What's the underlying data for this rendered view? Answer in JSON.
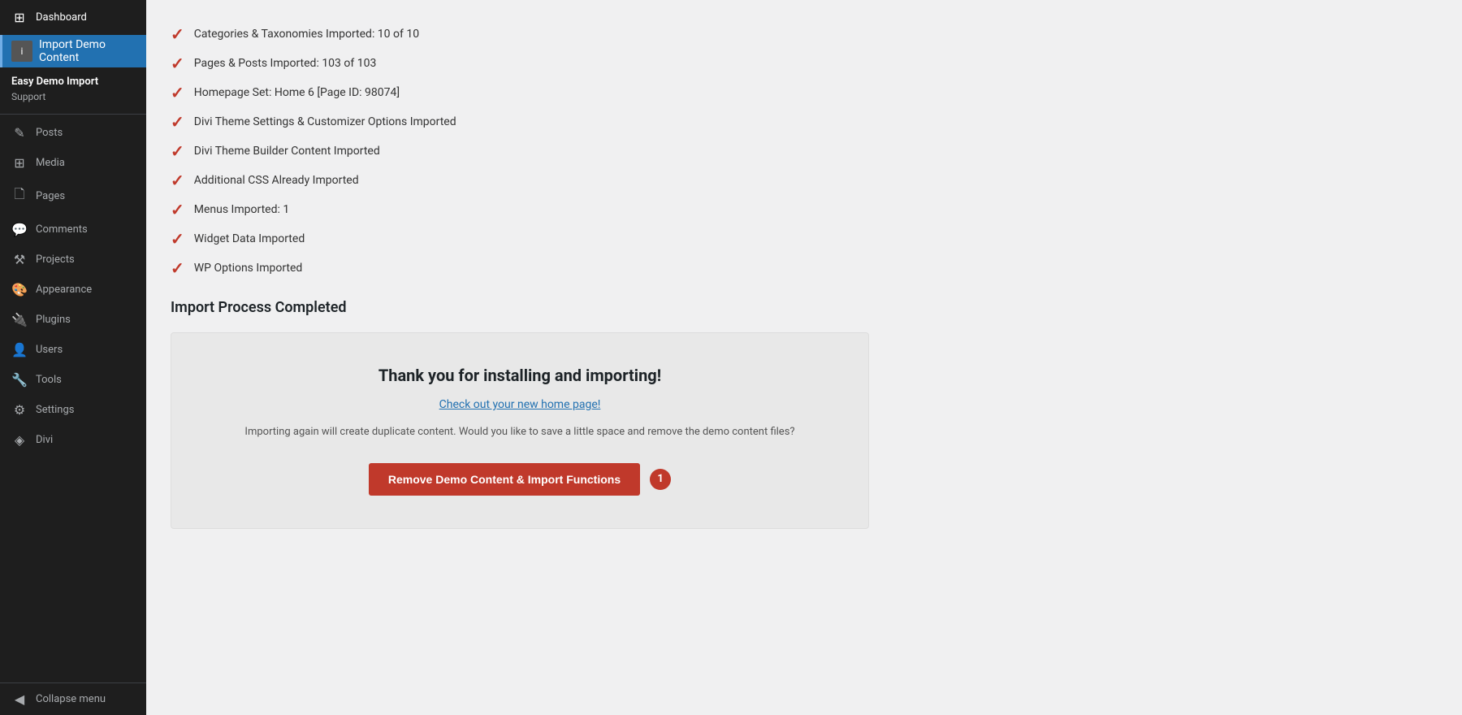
{
  "sidebar": {
    "dashboard_label": "Dashboard",
    "active_item_label": "Import Demo\nContent",
    "active_item_line1": "Import Demo",
    "active_item_line2": "Content",
    "plugin_section_title": "Easy Demo Import",
    "support_label": "Support",
    "items": [
      {
        "id": "posts",
        "label": "Posts",
        "icon": "✎"
      },
      {
        "id": "media",
        "label": "Media",
        "icon": "⊞"
      },
      {
        "id": "pages",
        "label": "Pages",
        "icon": "⬜"
      },
      {
        "id": "comments",
        "label": "Comments",
        "icon": "💬"
      },
      {
        "id": "projects",
        "label": "Projects",
        "icon": "🔧"
      },
      {
        "id": "appearance",
        "label": "Appearance",
        "icon": "🎨"
      },
      {
        "id": "plugins",
        "label": "Plugins",
        "icon": "🔌"
      },
      {
        "id": "users",
        "label": "Users",
        "icon": "👤"
      },
      {
        "id": "tools",
        "label": "Tools",
        "icon": "🔨"
      },
      {
        "id": "settings",
        "label": "Settings",
        "icon": "⚙"
      },
      {
        "id": "divi",
        "label": "Divi",
        "icon": "◈"
      }
    ],
    "collapse_label": "Collapse menu"
  },
  "main": {
    "checklist_items": [
      "Categories & Taxonomies Imported: 10 of 10",
      "Pages & Posts Imported: 103 of 103",
      "Homepage Set: Home 6 [Page ID: 98074]",
      "Divi Theme Settings & Customizer Options Imported",
      "Divi Theme Builder Content Imported",
      "Additional CSS Already Imported",
      "Menus Imported: 1",
      "Widget Data Imported",
      "WP Options Imported"
    ],
    "import_completed_title": "Import Process Completed",
    "thank_you_title": "Thank you for installing and importing!",
    "thank_you_link": "Check out your new home page!",
    "thank_you_desc": "Importing again will create duplicate content. Would you like to save a little space and remove the demo content files?",
    "remove_btn_label": "Remove Demo Content & Import Functions",
    "badge_count": "1"
  }
}
